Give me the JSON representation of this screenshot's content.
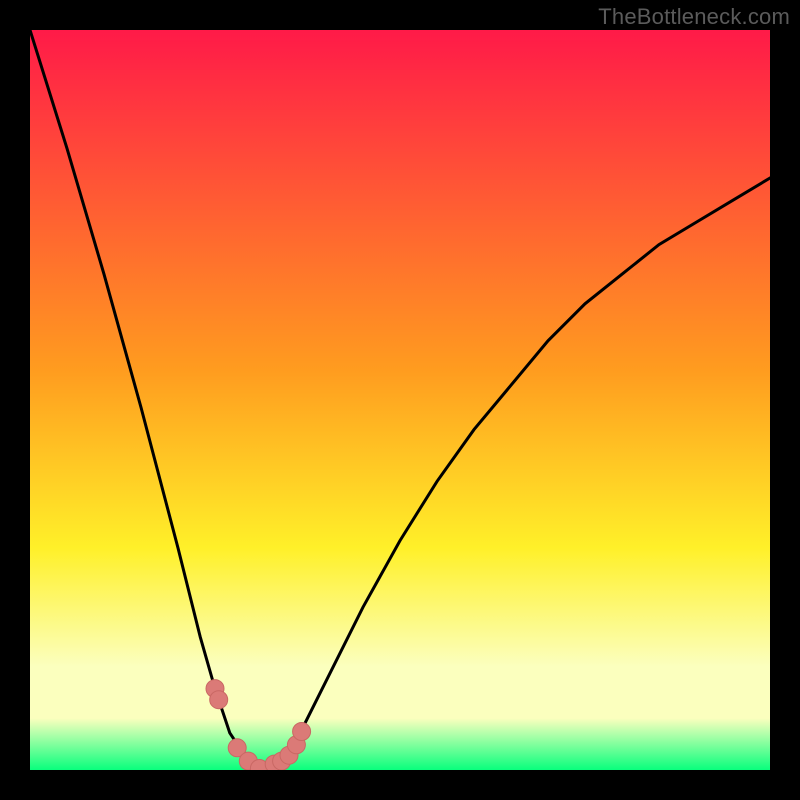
{
  "watermark": "TheBottleneck.com",
  "colors": {
    "frame": "#000000",
    "gradient_red": "#ff1a48",
    "gradient_orange": "#ff9c1f",
    "gradient_yellow": "#fff029",
    "gradient_cream": "#fbffbe",
    "gradient_green": "#09ff7d",
    "curve": "#000000",
    "marker_fill": "#db7a77",
    "marker_stroke": "#c96864"
  },
  "chart_data": {
    "type": "line",
    "title": "",
    "xlabel": "",
    "ylabel": "",
    "x_range": [
      0,
      100
    ],
    "y_range": [
      0,
      100
    ],
    "min_x_position": 31,
    "series": [
      {
        "name": "bottleneck-curve",
        "x": [
          0,
          5,
          10,
          15,
          20,
          23,
          25,
          27,
          29,
          31,
          33,
          35,
          37,
          40,
          45,
          50,
          55,
          60,
          65,
          70,
          75,
          80,
          85,
          90,
          95,
          100
        ],
        "y": [
          100,
          84,
          67,
          49,
          30,
          18,
          11,
          5,
          2,
          0,
          1,
          3,
          6,
          12,
          22,
          31,
          39,
          46,
          52,
          58,
          63,
          67,
          71,
          74,
          77,
          80
        ]
      }
    ],
    "markers": {
      "name": "highlighted-points",
      "x": [
        25.0,
        25.5,
        28.0,
        29.5,
        31.0,
        33.0,
        34.0,
        35.0,
        36.0,
        36.7
      ],
      "y": [
        11.0,
        9.5,
        3.0,
        1.2,
        0.2,
        0.8,
        1.2,
        2.0,
        3.4,
        5.2
      ]
    }
  }
}
